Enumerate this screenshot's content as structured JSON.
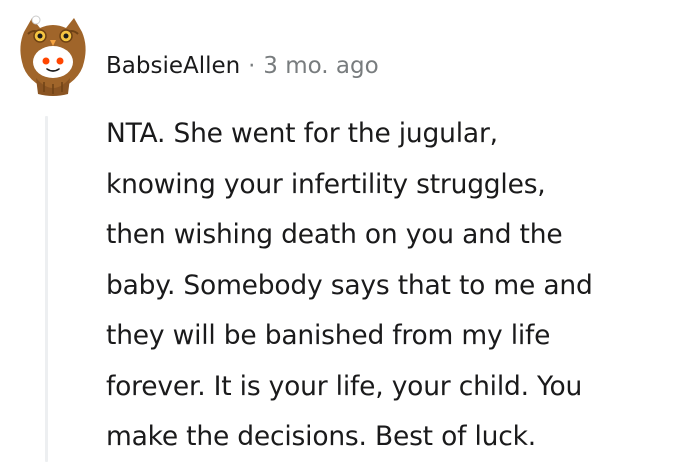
{
  "comment": {
    "author": "BabsieAllen",
    "separator": "·",
    "timestamp": "3 mo. ago",
    "avatar_icon": "owl-costume-avatar-icon",
    "body_lines": [
      "NTA. She went for the jugular,",
      "knowing your infertility struggles,",
      "then wishing death on you and the",
      "baby. Somebody says that to me and",
      "they will be banished from my life",
      "forever. It is your life, your child. You",
      "make the decisions. Best of luck."
    ]
  },
  "colors": {
    "text": "#1a1a1b",
    "meta": "#787c7e",
    "thread_line": "#edeff1",
    "avatar_owl": "#a0652a",
    "avatar_face": "#ffffff",
    "avatar_accent": "#ff4500"
  }
}
